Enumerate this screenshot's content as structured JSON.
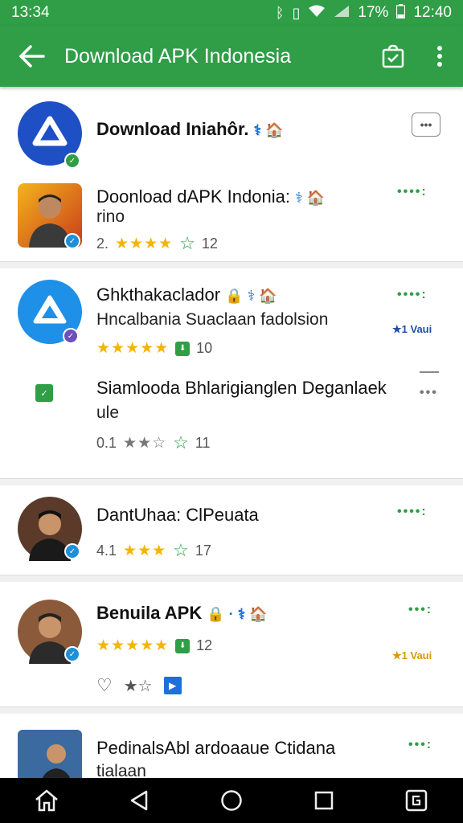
{
  "status_bar": {
    "time_left": "13:34",
    "battery": "17%",
    "time_right": "12:40"
  },
  "app_bar": {
    "title": "Download APK Indonesia"
  },
  "cards": [
    {
      "title": "Download Iniahôr.",
      "header_more": "•••"
    },
    {
      "title": "Doonload dAPK Indonia:",
      "subtitle": "rino",
      "rating": "2.",
      "stars": "★★★★",
      "count": "12",
      "dots": "••••:"
    },
    {
      "title": "Ghkthakaclador",
      "subtitle": "Hncalbania Suaclaan fadolsion",
      "stars": "★★★★★",
      "count": "10",
      "dots": "••••:",
      "rank": "★1 Vaui"
    },
    {
      "title": "Siamlooda Bhlarigianglen Deganlaek",
      "subtitle": "ule",
      "rating": "0.1",
      "stars": "★★☆",
      "count": "11",
      "dots": "•••"
    },
    {
      "title": "DantUhaa: ClPeuata",
      "rating": "4.1",
      "stars": "★★★",
      "count": "17",
      "dots": "••••:"
    },
    {
      "title": "Benuila APK",
      "stars": "★★★★★",
      "count": "12",
      "dots": "•••:",
      "rank": "★1 Vaui"
    },
    {
      "title": "PedinalsAbl ardoaaue Ctidana",
      "subtitle": "tialaan",
      "dots": "•••:"
    }
  ],
  "colors": {
    "primary": "#2f9e47",
    "accent": "#1e6fd9",
    "star": "#f4b400"
  }
}
